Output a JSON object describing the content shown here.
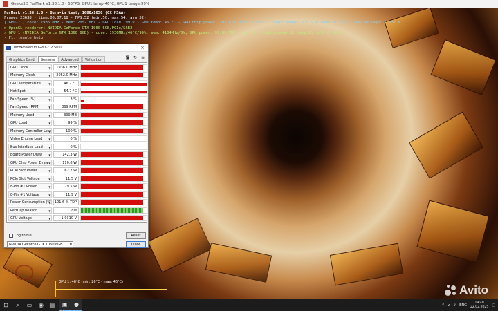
{
  "app": {
    "title": "Geeks3D FurMark v1.38.1.0 - 63FPS, GPU1 temp:46°C, GPU1 usage:99%"
  },
  "osd": {
    "line1": "FurMark v1.38.1.0 - Burn-in test, 1680x1050 (0X MSAA)",
    "line2": "Frames:23638 - time:00:07:18 - FPS:52 (min:50, max:54, avg:52)",
    "line3": "[ GPU-Z ] core: 1936 MHz - mem: 2052 MHz - GPU load: 99 % - GPU temp: 46 °C - GPU chip power: 103.4 W (PPW: 0.502) - Board power: 135.9 W (PPW: 0.382) - GPU voltage: 1.031 V",
    "line4": "> OpenGL renderer: NVIDIA GeForce GTX 1060 6GB/PCIe/SSE2",
    "line5": "> GPU 1 (NVIDIA GeForce GTX 1060 6GB) - core: 1936MHz/46°C/99%, mem: 4104MHz/6%, GPU power: 97.8% TDP, fan: 7%, limits(power:1, temp:0, volt:0, OV:0)",
    "line6": "- F1: toggle help"
  },
  "gpuz": {
    "title": "TechPowerUp GPU-Z 2.50.0",
    "tabs": [
      "Graphics Card",
      "Sensors",
      "Advanced",
      "Validation"
    ],
    "active_tab": "Sensors",
    "sensors": [
      {
        "name": "GPU Clock",
        "value": "1936.0 MHz",
        "level": 0.95
      },
      {
        "name": "Memory Clock",
        "value": "2052.0 MHz",
        "level": 0.95
      },
      {
        "name": "GPU Temperature",
        "value": "46.7 °C",
        "level": 0.55
      },
      {
        "name": "Hot Spot",
        "value": "54.7 °C",
        "level": 0.6
      },
      {
        "name": "Fan Speed (%)",
        "value": "3 %",
        "level": 0.05
      },
      {
        "name": "Fan Speed (RPM)",
        "value": "869 RPM",
        "level": 0.95
      },
      {
        "name": "Memory Used",
        "value": "399 MB",
        "level": 0.95
      },
      {
        "name": "GPU Load",
        "value": "99 %",
        "level": 0.95
      },
      {
        "name": "Memory Controller Load",
        "value": "100 %",
        "level": 0.95
      },
      {
        "name": "Video Engine Load",
        "value": "0 %",
        "level": 0.0
      },
      {
        "name": "Bus Interface Load",
        "value": "0 %",
        "level": 0.0
      },
      {
        "name": "Board Power Draw",
        "value": "142.3 W",
        "level": 0.95
      },
      {
        "name": "GPU Chip Power Draw",
        "value": "110.8 W",
        "level": 0.95
      },
      {
        "name": "PCIe Slot Power",
        "value": "62.2 W",
        "level": 0.95
      },
      {
        "name": "PCIe Slot Voltage",
        "value": "11.5 V",
        "level": 0.95
      },
      {
        "name": "8-Pin #1 Power",
        "value": "79.5 W",
        "level": 0.95
      },
      {
        "name": "8-Pin #1 Voltage",
        "value": "11.9 V",
        "level": 0.95
      },
      {
        "name": "Power Consumption (%)",
        "value": "101.6 % TDP",
        "level": 0.95
      },
      {
        "name": "PerfCap Reason",
        "value": "Idle",
        "level": 0.95
      },
      {
        "name": "GPU Voltage",
        "value": "1.0310 V",
        "level": 0.95
      }
    ],
    "log_to_file": "Log to file",
    "reset": "Reset",
    "close": "Close",
    "gpu_select": "NVIDIA GeForce GTX 1060 6GB"
  },
  "tempgraph": {
    "label": "GPU 1: 46°C (min: 26°C - max: 46°C)"
  },
  "watermark": "Avito",
  "taskbar": {
    "language": "ENG",
    "time": "19:40",
    "date": "22.02.2025"
  },
  "colors": {
    "sensor_bar": "#d40d0d",
    "perfcap_bar": "#2a9a2a",
    "osd_gpuz": "#7fd2ff",
    "osd_gpu1": "#b7f07a"
  }
}
